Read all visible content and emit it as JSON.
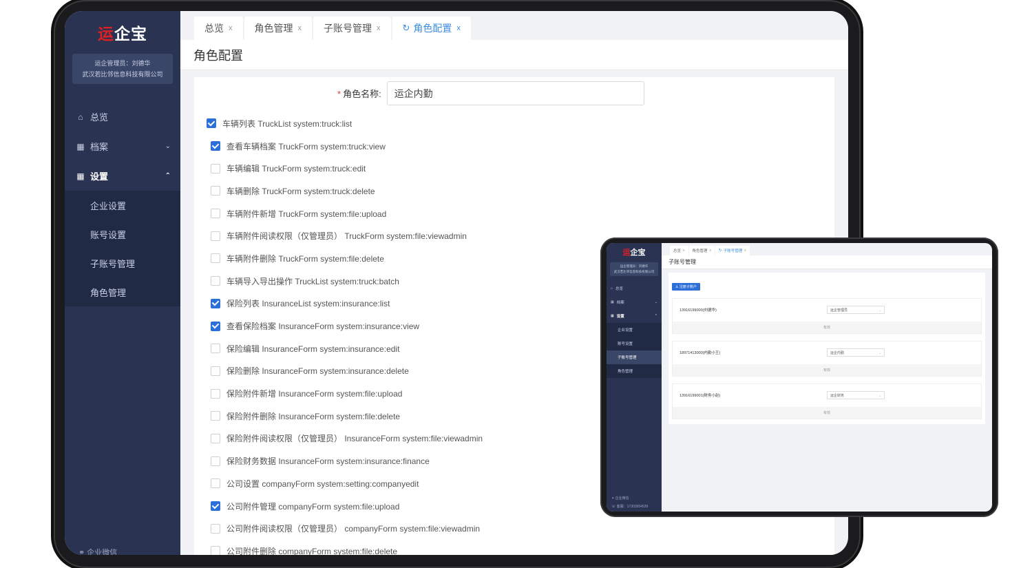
{
  "main_window": {
    "logo": {
      "part1": "运",
      "part2": "企宝"
    },
    "user": {
      "line1": "运企管理员：刘德华",
      "line2": "武汉若比邻信息科技有限公司"
    },
    "menu": [
      {
        "label": "总览",
        "icon": "home-icon"
      },
      {
        "label": "档案",
        "icon": "grid-icon",
        "arrow": "⌄"
      },
      {
        "label": "设置",
        "icon": "grid-icon",
        "arrow": "⌃"
      }
    ],
    "submenu": [
      "企业设置",
      "账号设置",
      "子账号管理",
      "角色管理"
    ],
    "sidebar_footer": "⚭ 企业微信",
    "tabs": [
      {
        "label": "总览"
      },
      {
        "label": "角色管理"
      },
      {
        "label": "子账号管理"
      },
      {
        "label": "角色配置"
      }
    ],
    "tab_close": "x",
    "page_title": "角色配置",
    "form": {
      "role_label": "角色名称:",
      "required_mark": "*",
      "role_value": "运企内勤"
    },
    "permissions": [
      {
        "label": "车辆列表 TruckList system:truck:list",
        "checked": true,
        "level": 0
      },
      {
        "label": "查看车辆档案 TruckForm system:truck:view",
        "checked": true,
        "level": 1
      },
      {
        "label": "车辆编辑 TruckForm system:truck:edit",
        "checked": false,
        "level": 1
      },
      {
        "label": "车辆删除 TruckForm system:truck:delete",
        "checked": false,
        "level": 1
      },
      {
        "label": "车辆附件新增 TruckForm system:file:upload",
        "checked": false,
        "level": 1
      },
      {
        "label": "车辆附件阅读权限（仅管理员） TruckForm system:file:viewadmin",
        "checked": false,
        "level": 1
      },
      {
        "label": "车辆附件删除 TruckForm system:file:delete",
        "checked": false,
        "level": 1
      },
      {
        "label": "车辆导入导出操作 TruckList system:truck:batch",
        "checked": false,
        "level": 1
      },
      {
        "label": "保险列表 InsuranceList system:insurance:list",
        "checked": true,
        "level": 1
      },
      {
        "label": "查看保险档案 InsuranceForm system:insurance:view",
        "checked": true,
        "level": 1
      },
      {
        "label": "保险编辑 InsuranceForm system:insurance:edit",
        "checked": false,
        "level": 1
      },
      {
        "label": "保险删除 InsuranceForm system:insurance:delete",
        "checked": false,
        "level": 1
      },
      {
        "label": "保险附件新增 InsuranceForm system:file:upload",
        "checked": false,
        "level": 1
      },
      {
        "label": "保险附件删除 InsuranceForm system:file:delete",
        "checked": false,
        "level": 1
      },
      {
        "label": "保险附件阅读权限（仅管理员） InsuranceForm system:file:viewadmin",
        "checked": false,
        "level": 1
      },
      {
        "label": "保险财务数据 InsuranceForm system:insurance:finance",
        "checked": false,
        "level": 1
      },
      {
        "label": "公司设置 companyForm system:setting:companyedit",
        "checked": false,
        "level": 1
      },
      {
        "label": "公司附件管理 companyForm system:file:upload",
        "checked": true,
        "level": 1
      },
      {
        "label": "公司附件阅读权限（仅管理员） companyForm system:file:viewadmin",
        "checked": false,
        "level": 1
      },
      {
        "label": "公司附件删除 companyForm system:file:delete",
        "checked": false,
        "level": 1
      }
    ]
  },
  "small_window": {
    "logo": {
      "part1": "运",
      "part2": "企宝"
    },
    "user": {
      "line1": "运企管理员：刘德华",
      "line2": "武汉若比邻信息科技有限公司"
    },
    "menu": [
      {
        "label": "总览"
      },
      {
        "label": "档案"
      },
      {
        "label": "设置"
      }
    ],
    "submenu": [
      "企业设置",
      "账号设置",
      "子账号管理",
      "角色管理"
    ],
    "footer1": "⚭ 企业微信",
    "footer2": "☏ 客服：17303954539",
    "tabs": [
      {
        "label": "总览"
      },
      {
        "label": "角色管理"
      },
      {
        "label": "子账号管理"
      }
    ],
    "page_title": "子账号管理",
    "register_button": "♙ 注册子账户",
    "accounts": [
      {
        "phone": "13916199000(刘德华)",
        "role": "运企管理员",
        "status": "有效"
      },
      {
        "phone": "18971413000(内勤小王)",
        "role": "运企内勤",
        "status": "有效"
      },
      {
        "phone": "13916199001(财务小赵)",
        "role": "运企财务",
        "status": "有效"
      }
    ]
  },
  "colors": {
    "sidebar": "#2a3452",
    "accent": "#2d6fd8",
    "logo_red": "#e01f24"
  }
}
